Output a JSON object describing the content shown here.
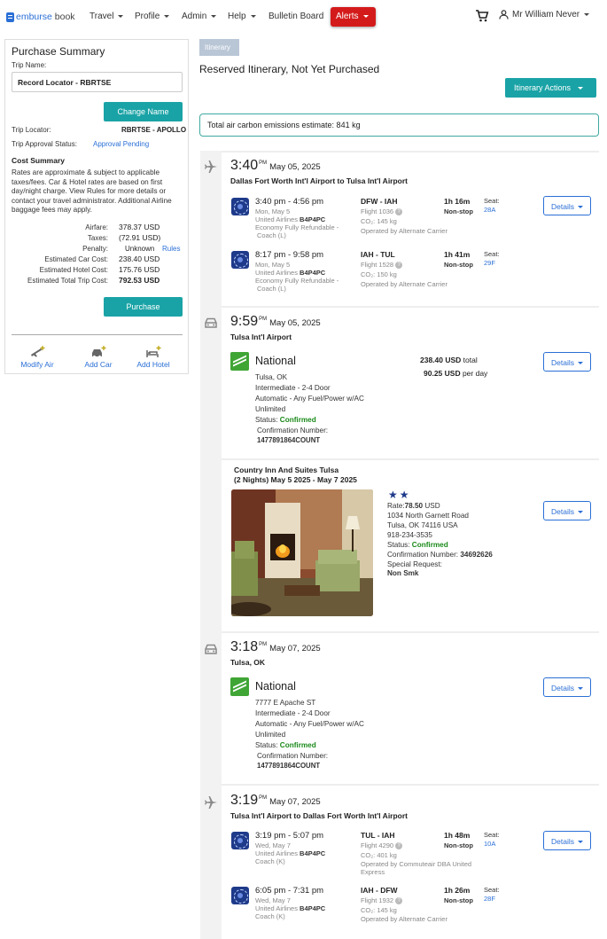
{
  "nav": {
    "brand_prefix": "emburse",
    "brand_suffix": " book",
    "items": [
      "Travel",
      "Profile",
      "Admin",
      "Help"
    ],
    "bulletin": "Bulletin Board",
    "alerts": "Alerts",
    "user": "Mr William Never"
  },
  "summary": {
    "title": "Purchase Summary",
    "trip_name_label": "Trip Name:",
    "trip_name_value": "Record Locator - RBRTSE",
    "change_name": "Change Name",
    "trip_locator_label": "Trip Locator:",
    "trip_locator_value": "RBRTSE - APOLLO",
    "approval_label": "Trip Approval Status:",
    "approval_value": "Approval Pending",
    "cost_title": "Cost Summary",
    "cost_note": "Rates are approximate & subject to applicable taxes/fees.  Car & Hotel rates are based on first day/night charge. View Rules for more details or contact your travel administrator. Additional Airline baggage fees may apply.",
    "airfare_label": "Airfare:",
    "airfare_value": "378.37  USD",
    "taxes_label": "Taxes:",
    "taxes_value": "(72.91  USD)",
    "penalty_label": "Penalty:",
    "penalty_value": "Unknown",
    "rules": "Rules",
    "car_label": "Estimated Car Cost:",
    "car_value": "238.40  USD",
    "hotel_label": "Estimated Hotel Cost:",
    "hotel_value": "175.76  USD",
    "total_label": "Estimated Total Trip Cost:",
    "total_value": "792.53  USD",
    "purchase": "Purchase",
    "modify_air": "Modify Air",
    "add_car": "Add Car",
    "add_hotel": "Add Hotel"
  },
  "itinerary": {
    "tab": "Itinerary",
    "title": "Reserved Itinerary, Not Yet Purchased",
    "actions": "Itinerary Actions",
    "carbon": "Total air carbon emissions estimate: 841 kg",
    "details": "Details"
  },
  "seg1": {
    "time": "3:40",
    "ampm": "PM",
    "date": "May 05, 2025",
    "route": "Dallas Fort Worth Int'l Airport to Tulsa Int'l Airport",
    "f1": {
      "times": "3:40 pm - 4:56 pm",
      "day": "Mon, May 5",
      "airline": "United Airlines",
      "code": "B4P4PC",
      "fare1": "Economy Fully Refundable -",
      "fare2": "Coach (L)",
      "route": "DFW - IAH",
      "flight": "Flight 1036",
      "co2": "CO₂: 145 kg",
      "operated": "Operated by Alternate Carrier",
      "duration": "1h 16m",
      "stops": "Non-stop",
      "seat_label": "Seat:",
      "seat": "28A"
    },
    "f2": {
      "times": "8:17 pm - 9:58 pm",
      "day": "Mon, May 5",
      "airline": "United Airlines",
      "code": "B4P4PC",
      "fare1": "Economy Fully Refundable -",
      "fare2": "Coach (L)",
      "route": "IAH - TUL",
      "flight": "Flight 1528",
      "co2": "CO₂: 150 kg",
      "operated": "Operated by Alternate Carrier",
      "duration": "1h 41m",
      "stops": "Non-stop",
      "seat_label": "Seat:",
      "seat": "29F"
    }
  },
  "seg2": {
    "time": "9:59",
    "ampm": "PM",
    "date": "May 05, 2025",
    "place": "Tulsa Int'l Airport",
    "vendor": "National",
    "l1": "Tulsa, OK",
    "l2": "Intermediate - 2-4 Door",
    "l3": "Automatic - Any Fuel/Power w/AC",
    "l4": "Unlimited",
    "status_label": "Status:",
    "status": "Confirmed",
    "conf_label": "Confirmation Number:",
    "conf": "1477891864COUNT",
    "total": "238.40 USD",
    "total_suffix": " total",
    "perday": "90.25  USD",
    "perday_suffix": " per day"
  },
  "hotel": {
    "name": "Country Inn And Suites Tulsa",
    "dates": "(2 Nights) May 5 2025 - May 7 2025",
    "stars": "★★",
    "rate_label": "Rate:",
    "rate": "78.50",
    "rate_cur": " USD",
    "addr1": "1034 North Garnett Road",
    "addr2": "Tulsa, OK 74116 USA",
    "phone": "918-234-3535",
    "status_label": "Status:",
    "status": "Confirmed",
    "conf_label": "Confirmation Number:",
    "conf": "34692626",
    "special_label": "Special Request:",
    "special": "Non Smk"
  },
  "seg4": {
    "time": "3:18",
    "ampm": "PM",
    "date": "May 07, 2025",
    "place": "Tulsa, OK",
    "vendor": "National",
    "l1": "7777 E Apache ST",
    "l2": "Intermediate - 2-4 Door",
    "l3": "Automatic - Any Fuel/Power w/AC",
    "l4": "Unlimited",
    "status_label": "Status:",
    "status": "Confirmed",
    "conf_label": "Confirmation Number:",
    "conf": "1477891864COUNT"
  },
  "seg5": {
    "time": "3:19",
    "ampm": "PM",
    "date": "May 07, 2025",
    "route": "Tulsa Int'l Airport to Dallas Fort Worth Int'l Airport",
    "f1": {
      "times": "3:19 pm - 5:07 pm",
      "day": "Wed, May 7",
      "airline": "United Airlines",
      "code": "B4P4PC",
      "fare1": "Coach (K)",
      "route": "TUL - IAH",
      "flight": "Flight 4290",
      "co2": "CO₂: 401 kg",
      "operated": "Operated by Commuteair DBA United",
      "operated2": "Express",
      "duration": "1h 48m",
      "stops": "Non-stop",
      "seat_label": "Seat:",
      "seat": "10A"
    },
    "f2": {
      "times": "6:05 pm - 7:31 pm",
      "day": "Wed, May 7",
      "airline": "United Airlines",
      "code": "B4P4PC",
      "fare1": "Coach (K)",
      "route": "IAH - DFW",
      "flight": "Flight 1932",
      "co2": "CO₂: 145 kg",
      "operated": "Operated by Alternate Carrier",
      "duration": "1h 26m",
      "stops": "Non-stop",
      "seat_label": "Seat:",
      "seat": "28F"
    }
  }
}
